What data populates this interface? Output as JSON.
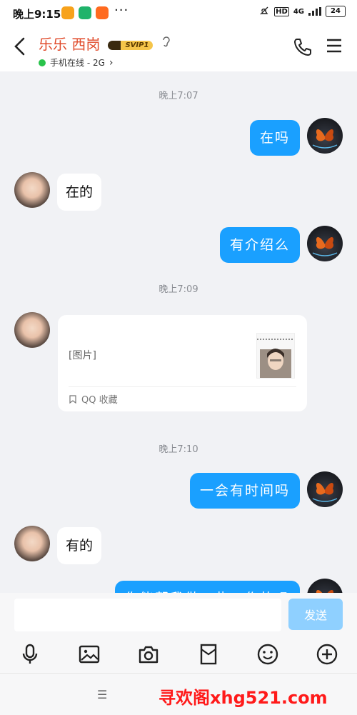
{
  "status_bar": {
    "time": "晚上9:15",
    "dots": "···",
    "network": "HD",
    "signal": "4G",
    "battery": "24"
  },
  "header": {
    "title": "乐乐 西岗",
    "badge": "SVIP1",
    "online_status": "手机在线 - 2G",
    "online_chevron": "›"
  },
  "chat": {
    "time_1": "晚上7:07",
    "time_2": "晚上7:09",
    "time_3": "晚上7:10",
    "msg_1": "在吗",
    "msg_2": "在的",
    "msg_3": "有介绍么",
    "card_text": "[图片]",
    "card_footer": "QQ 收藏",
    "msg_4": "一会有时间吗",
    "msg_5": "有的",
    "msg_6": "你能帮我做一些工作的吗"
  },
  "input": {
    "placeholder": "",
    "send_label": "发送"
  },
  "toolbar": {
    "items": [
      "mic-icon",
      "image-icon",
      "camera-icon",
      "red-packet-icon",
      "emoji-icon",
      "plus-icon"
    ]
  },
  "navbar": {
    "menu": "☰",
    "watermark": "寻欢阁xhg521.com"
  },
  "colors": {
    "accent_blue": "#1aa0ff",
    "title_red": "#e04a2a",
    "online_green": "#29c34b",
    "send_disabled": "#8fd0ff"
  }
}
